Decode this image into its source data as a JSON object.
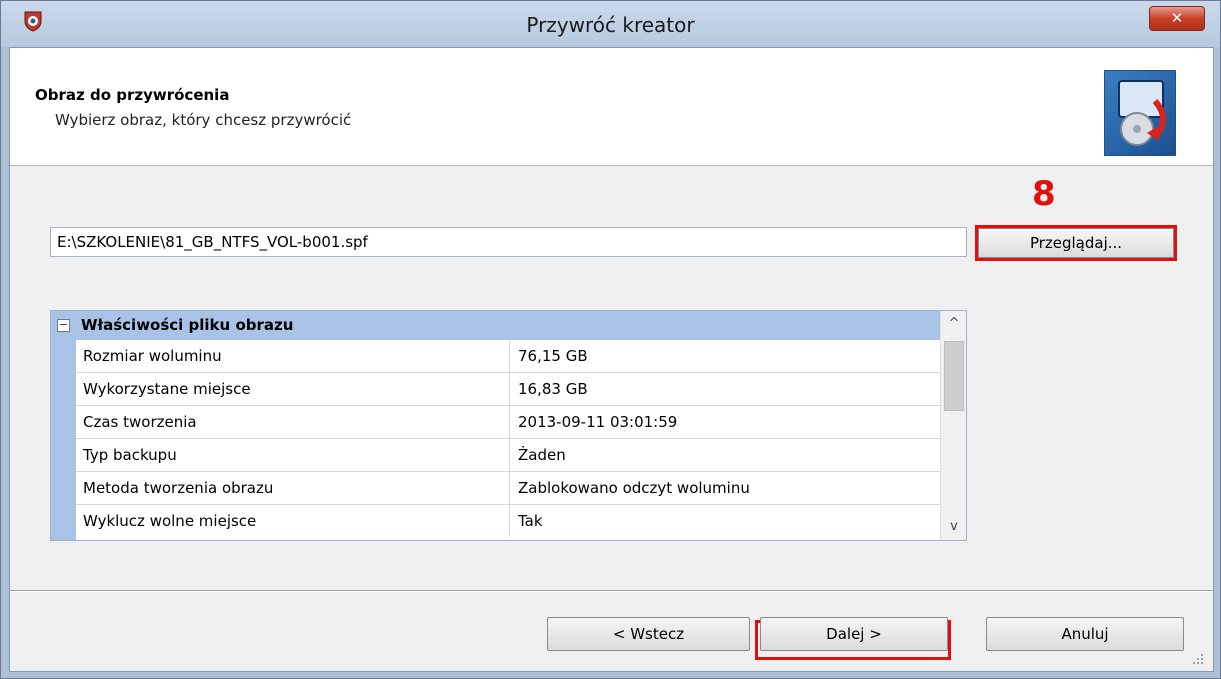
{
  "window": {
    "title": "Przywróć kreator",
    "close_label": "✕"
  },
  "header": {
    "title": "Obraz do przywrócenia",
    "subtitle": "Wybierz obraz, który chcesz przywrócić"
  },
  "annotation": {
    "step_number": "8"
  },
  "image_path": {
    "value": "E:\\SZKOLENIE\\81_GB_NTFS_VOL-b001.spf",
    "browse_label": "Przeglądaj..."
  },
  "properties": {
    "section_title": "Właściwości pliku obrazu",
    "collapse_symbol": "−",
    "rows": [
      {
        "name": "Rozmiar woluminu",
        "value": "76,15 GB"
      },
      {
        "name": "Wykorzystane miejsce",
        "value": "16,83 GB"
      },
      {
        "name": "Czas tworzenia",
        "value": "2013-09-11 03:01:59"
      },
      {
        "name": "Typ backupu",
        "value": "Żaden"
      },
      {
        "name": "Metoda tworzenia obrazu",
        "value": "Zablokowano odczyt woluminu"
      },
      {
        "name": "Wyklucz wolne miejsce",
        "value": "Tak"
      }
    ],
    "scroll_up": "^",
    "scroll_down": "v"
  },
  "footer": {
    "back_label": "< Wstecz",
    "next_label": "Dalej >",
    "cancel_label": "Anuluj"
  },
  "colors": {
    "highlight_red": "#e01010",
    "grid_header": "#a8c3e6",
    "window_frame": "#aebfd6"
  }
}
